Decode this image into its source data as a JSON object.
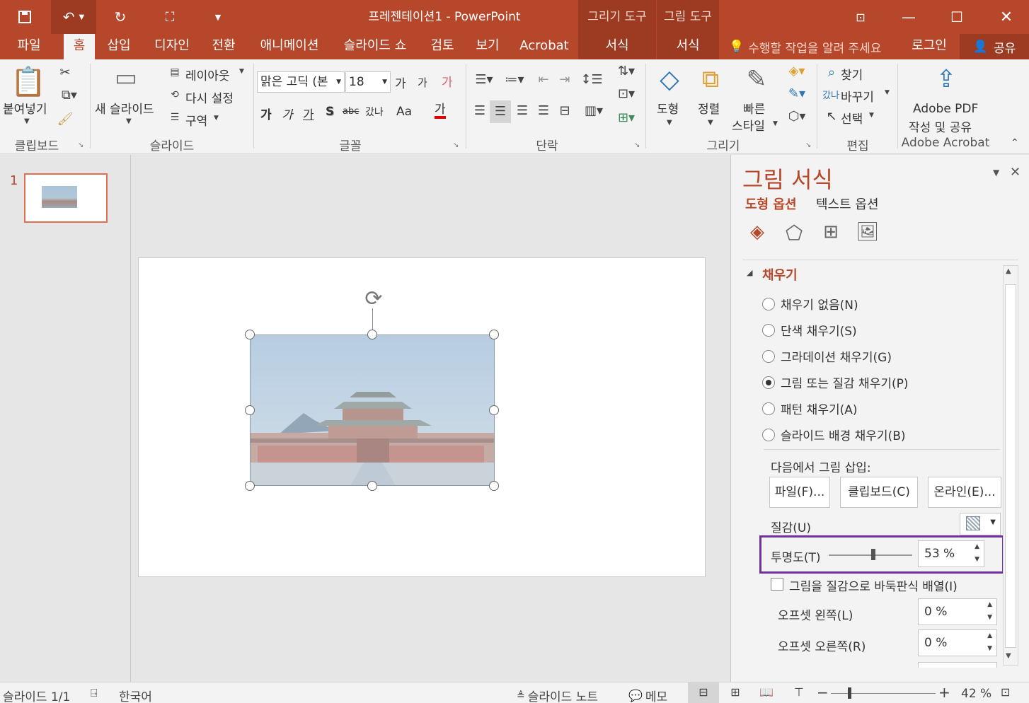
{
  "window": {
    "title": "프레젠테이션1 - PowerPoint",
    "context_groups": [
      "그리기 도구",
      "그림 도구"
    ]
  },
  "tabs": [
    "파일",
    "홈",
    "삽입",
    "디자인",
    "전환",
    "애니메이션",
    "슬라이드 쇼",
    "검토",
    "보기",
    "Acrobat",
    "서식",
    "서식"
  ],
  "active_tab": "홈",
  "tell_me": "수행할 작업을 알려 주세요",
  "signin": "로그인",
  "share": "공유",
  "ribbon": {
    "clipboard": {
      "paste": "붙여넣기",
      "label": "클립보드"
    },
    "slides": {
      "new_slide": "새 슬라이드",
      "layout": "레이아웃",
      "reset": "다시 설정",
      "section": "구역",
      "label": "슬라이드"
    },
    "font": {
      "font_name": "맑은 고딕 (본",
      "font_size": "18",
      "grow": "가",
      "shrink": "가",
      "clear": "가",
      "bold": "가",
      "italic": "가",
      "underline": "가",
      "shadow": "S",
      "strike": "abc",
      "spacing": "갔나",
      "case": "Aa",
      "color": "가",
      "label": "글꼴"
    },
    "paragraph": {
      "label": "단락"
    },
    "drawing": {
      "shapes": "도형",
      "arrange": "정렬",
      "quick_styles_1": "빠른",
      "quick_styles_2": "스타일",
      "label": "그리기"
    },
    "editing": {
      "find": "찾기",
      "replace": "바꾸기",
      "replace_icon": "갔나",
      "select": "선택",
      "label": "편집"
    },
    "acrobat": {
      "create_1": "Adobe PDF",
      "create_2": "작성 및 공유",
      "label": "Adobe Acrobat"
    }
  },
  "thumbnails": [
    {
      "number": "1"
    }
  ],
  "pane": {
    "title": "그림 서식",
    "tab_shape": "도형 옵션",
    "tab_text": "텍스트 옵션",
    "section": "채우기",
    "fill_options": [
      {
        "label": "채우기 없음(N)",
        "selected": false
      },
      {
        "label": "단색 채우기(S)",
        "selected": false
      },
      {
        "label": "그라데이션 채우기(G)",
        "selected": false
      },
      {
        "label": "그림 또는 질감 채우기(P)",
        "selected": true
      },
      {
        "label": "패턴 채우기(A)",
        "selected": false
      },
      {
        "label": "슬라이드 배경 채우기(B)",
        "selected": false
      }
    ],
    "insert_from": "다음에서 그림 삽입:",
    "btn_file": "파일(F)...",
    "btn_clipboard": "클립보드(C)",
    "btn_online": "온라인(E)...",
    "texture": "질감(U)",
    "transparency_label": "투명도(T)",
    "transparency_value": "53 %",
    "transparency": 0.53,
    "tile_label": "그림을 질감으로 바둑판식 배열(I)",
    "offset_left_label": "오프셋 왼쪽(L)",
    "offset_left": "0 %",
    "offset_right_label": "오프셋 오른쪽(R)",
    "offset_right": "0 %"
  },
  "status": {
    "slide": "슬라이드 1/1",
    "language": "한국어",
    "notes": "슬라이드 노트",
    "comments": "메모",
    "zoom": "42 %",
    "zoom_fraction": 0.42
  },
  "colors": {
    "accent": "#b7472a",
    "highlight": "#7030a0"
  }
}
